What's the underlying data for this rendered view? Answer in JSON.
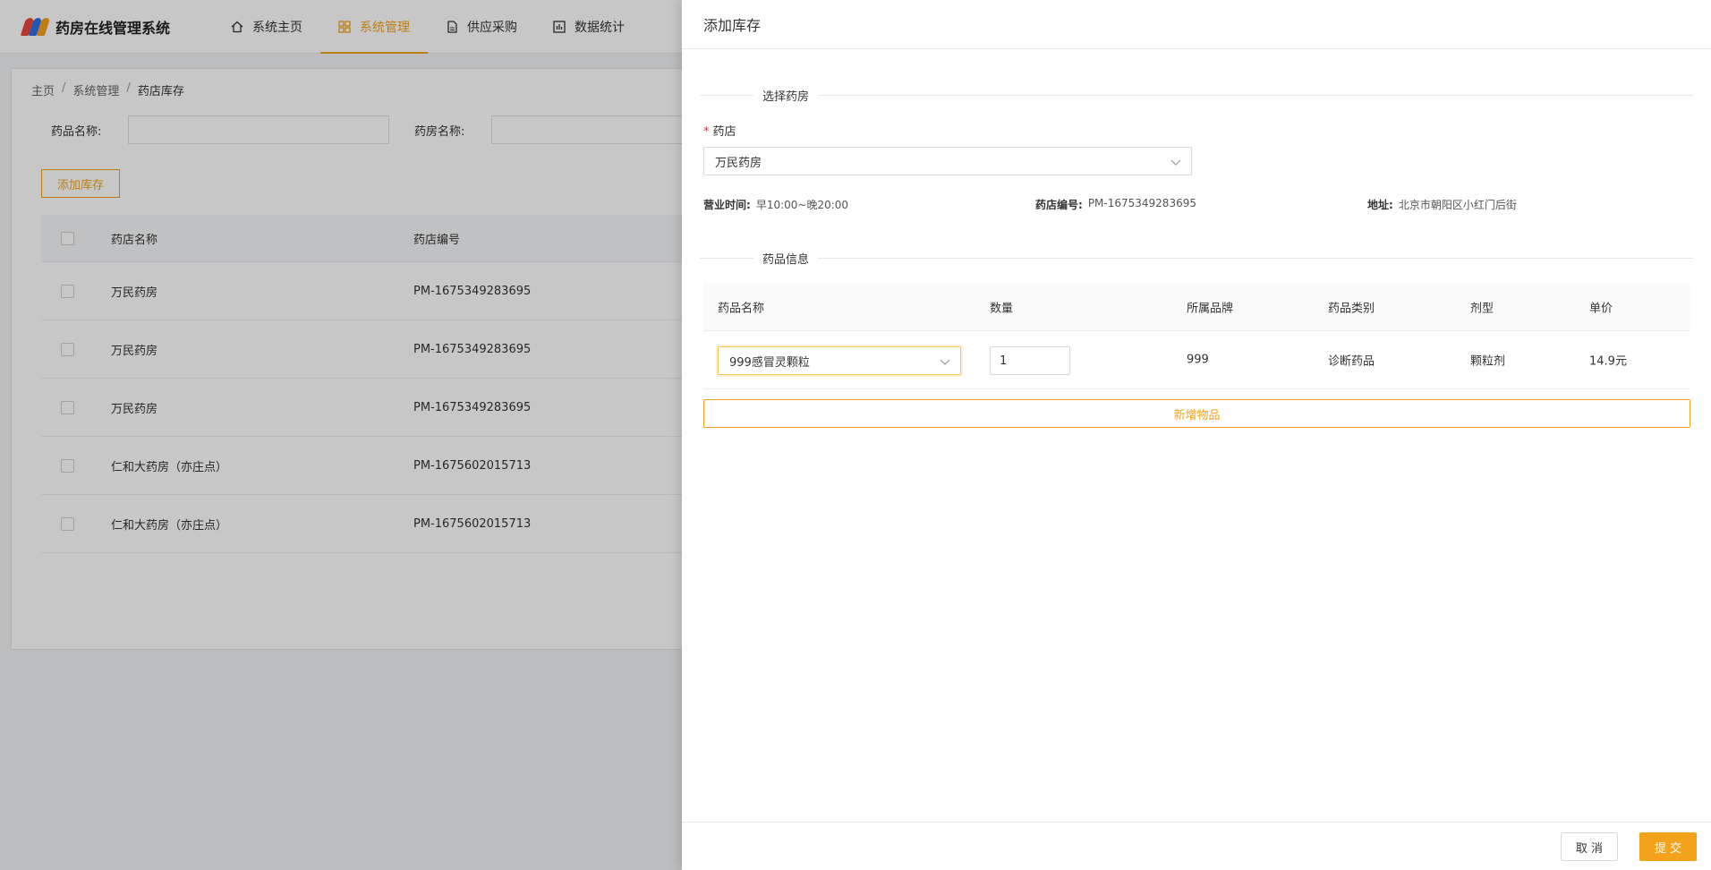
{
  "app": {
    "title": "药房在线管理系统"
  },
  "nav": [
    {
      "label": "系统主页",
      "icon": "home-icon"
    },
    {
      "label": "系统管理",
      "icon": "grid-icon",
      "active": true
    },
    {
      "label": "供应采购",
      "icon": "document-icon"
    },
    {
      "label": "数据统计",
      "icon": "chart-icon"
    }
  ],
  "breadcrumb": {
    "home": "主页",
    "sep": "/",
    "section": "系统管理",
    "current": "药店库存"
  },
  "filters": {
    "drug_label": "药品名称:",
    "pharmacy_label": "药房名称:"
  },
  "list": {
    "add_button": "添加库存",
    "headers": {
      "name": "药店名称",
      "code": "药店编号"
    },
    "rows": [
      {
        "name": "万民药房",
        "code": "PM-1675349283695"
      },
      {
        "name": "万民药房",
        "code": "PM-1675349283695"
      },
      {
        "name": "万民药房",
        "code": "PM-1675349283695"
      },
      {
        "name": "仁和大药房（亦庄点）",
        "code": "PM-1675602015713"
      },
      {
        "name": "仁和大药房（亦庄点）",
        "code": "PM-1675602015713"
      }
    ]
  },
  "drawer": {
    "title": "添加库存",
    "section_pharmacy": "选择药房",
    "required_mark": "*",
    "store_label": "药店",
    "store_value": "万民药房",
    "info": {
      "hours_label": "营业时间:",
      "hours_value": "早10:00~晚20:00",
      "code_label": "药店编号:",
      "code_value": "PM-1675349283695",
      "address_label": "地址:",
      "address_value": "北京市朝阳区小红门后街"
    },
    "section_drugs": "药品信息",
    "items_headers": {
      "name": "药品名称",
      "qty": "数量",
      "brand": "所属品牌",
      "category": "药品类别",
      "form": "剂型",
      "price": "单价"
    },
    "items": [
      {
        "name": "999感冒灵颗粒",
        "qty": "1",
        "brand": "999",
        "category": "诊断药品",
        "form": "颗粒剂",
        "price": "14.9元"
      }
    ],
    "add_item": "新增物品",
    "cancel": "取 消",
    "submit": "提 交"
  },
  "colors": {
    "accent": "#f2a21b",
    "mask": "rgba(0,0,0,0.22)"
  }
}
